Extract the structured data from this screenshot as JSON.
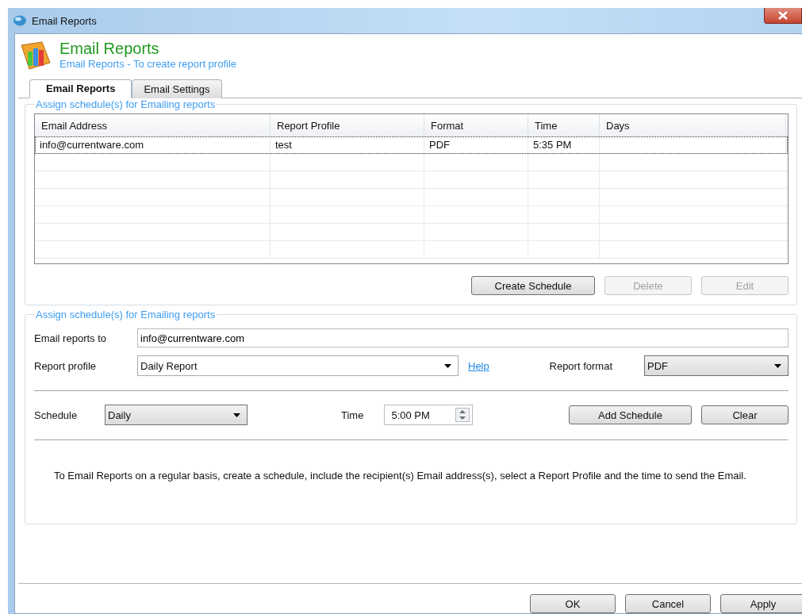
{
  "window": {
    "title": "Email Reports"
  },
  "header": {
    "title": "Email Reports",
    "subtitle": "Email Reports - To create report profile"
  },
  "tabs": [
    {
      "label": "Email Reports",
      "selected": true
    },
    {
      "label": "Email Settings",
      "selected": false
    }
  ],
  "schedules_group": {
    "legend": "Assign schedule(s) for Emailing reports",
    "table": {
      "columns": [
        "Email Address",
        "Report Profile",
        "Format",
        "Time",
        "Days"
      ],
      "rows": [
        {
          "cells": [
            "info@currentware.com",
            "test",
            "PDF",
            "5:35 PM"
          ],
          "selected": true
        }
      ]
    },
    "buttons": [
      {
        "label": "Create Schedule",
        "disabled": false
      },
      {
        "label": "Delete",
        "disabled": true
      },
      {
        "label": "Edit",
        "disabled": true
      }
    ]
  },
  "form_group": {
    "legend": "Assign schedule(s) for Emailing reports",
    "email_label": "Email reports to",
    "email_value": "info@currentware.com",
    "profile_label": "Report profile",
    "profile_value": "Daily Report",
    "help_link": "Help",
    "format_label": "Report format",
    "format_value": "PDF",
    "schedule_label": "Schedule",
    "schedule_value": "Daily",
    "time_label": "Time",
    "time_value": "5:00 PM",
    "buttons": [
      {
        "label": "Add Schedule",
        "disabled": false
      },
      {
        "label": "Clear",
        "disabled": false
      }
    ],
    "note": "To Email Reports on a regular basis, create a schedule, include the recipient(s) Email address(s), select a Report Profile and the time to send the Email."
  },
  "footer_buttons": [
    {
      "label": "OK",
      "disabled": false
    },
    {
      "label": "Cancel",
      "disabled": false
    },
    {
      "label": "Apply",
      "disabled": false
    }
  ]
}
